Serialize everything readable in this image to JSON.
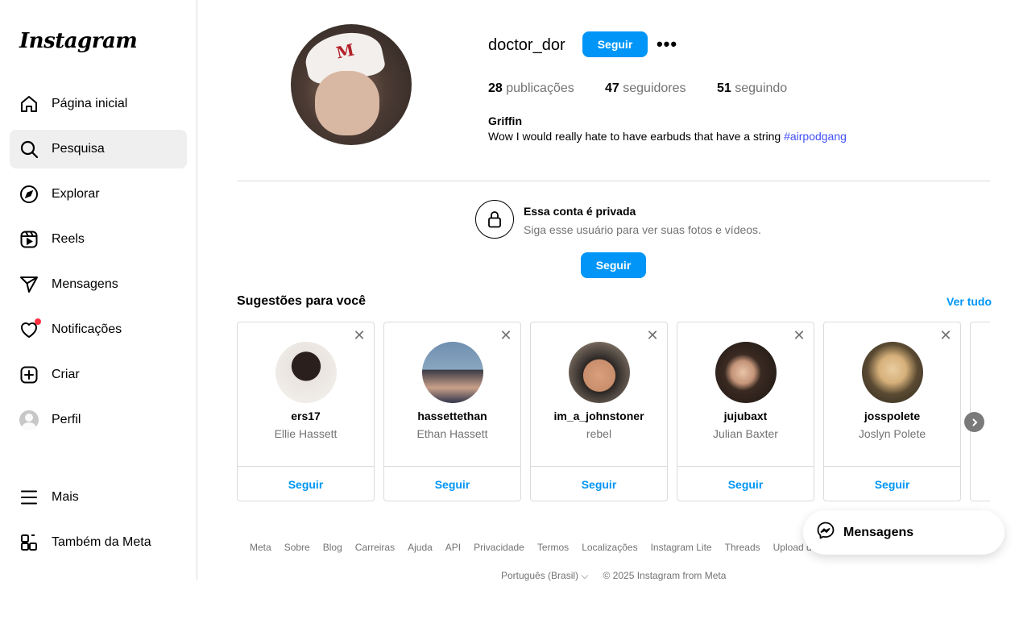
{
  "app": {
    "logo": "Instagram"
  },
  "sidebar": {
    "items": [
      {
        "label": "Página inicial",
        "icon": "home-icon"
      },
      {
        "label": "Pesquisa",
        "icon": "search-icon"
      },
      {
        "label": "Explorar",
        "icon": "compass-icon"
      },
      {
        "label": "Reels",
        "icon": "reels-icon"
      },
      {
        "label": "Mensagens",
        "icon": "send-icon"
      },
      {
        "label": "Notificações",
        "icon": "heart-icon"
      },
      {
        "label": "Criar",
        "icon": "plus-square-icon"
      },
      {
        "label": "Perfil",
        "icon": "avatar"
      },
      {
        "label": "Mais",
        "icon": "menu-icon"
      },
      {
        "label": "Também da Meta",
        "icon": "meta-apps-icon"
      }
    ],
    "active": "Pesquisa"
  },
  "profile": {
    "username": "doctor_dor",
    "follow_label": "Seguir",
    "more_label": "•••",
    "posts_count": "28",
    "posts_label": " publicações",
    "followers_count": "47",
    "followers_label": " seguidores",
    "following_count": "51",
    "following_label": " seguindo",
    "name": "Griffin",
    "bio_text": "Wow I would really hate to have earbuds that have a string ",
    "bio_hashtag": "#airpodgang"
  },
  "private": {
    "title": "Essa conta é privada",
    "subtitle": "Siga esse usuário para ver suas fotos e vídeos.",
    "follow_label": "Seguir"
  },
  "suggestions": {
    "title": "Sugestões para você",
    "see_all": "Ver tudo",
    "cards": [
      {
        "username": "ers17",
        "name": "Ellie Hassett",
        "follow": "Seguir"
      },
      {
        "username": "hassettethan",
        "name": "Ethan Hassett",
        "follow": "Seguir"
      },
      {
        "username": "im_a_johnstoner",
        "name": "rebel",
        "follow": "Seguir"
      },
      {
        "username": "jujubaxt",
        "name": "Julian Baxter",
        "follow": "Seguir"
      },
      {
        "username": "josspolete",
        "name": "Joslyn Polete",
        "follow": "Seguir"
      }
    ]
  },
  "footer": {
    "links": [
      "Meta",
      "Sobre",
      "Blog",
      "Carreiras",
      "Ajuda",
      "API",
      "Privacidade",
      "Termos",
      "Localizações",
      "Instagram Lite",
      "Threads",
      "Upload de c"
    ],
    "language": "Português (Brasil)",
    "copyright": "© 2025 Instagram from Meta"
  },
  "messenger": {
    "label": "Mensagens"
  },
  "colors": {
    "accent": "#0095f6",
    "hashtag": "#4150f7",
    "notification": "#ff3040"
  }
}
